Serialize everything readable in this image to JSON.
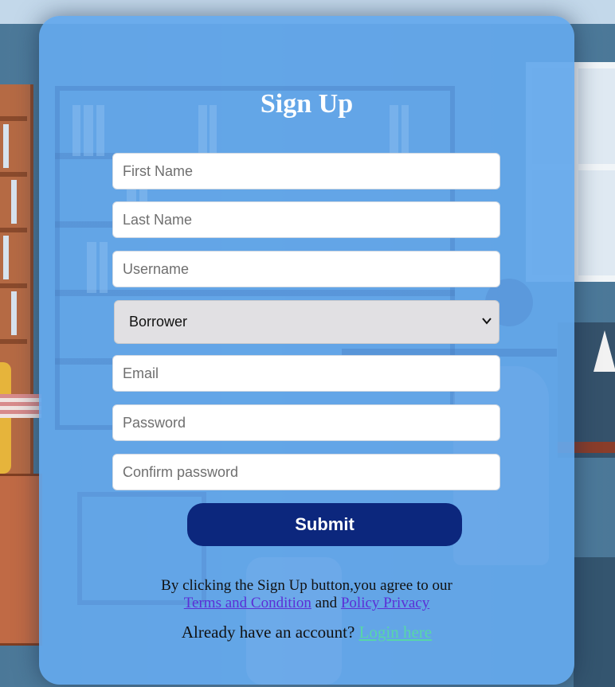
{
  "form": {
    "title": "Sign Up",
    "fields": {
      "first_name": {
        "placeholder": "First Name",
        "value": ""
      },
      "last_name": {
        "placeholder": "Last Name",
        "value": ""
      },
      "username": {
        "placeholder": "Username",
        "value": ""
      },
      "email": {
        "placeholder": "Email",
        "value": ""
      },
      "password": {
        "placeholder": "Password",
        "value": ""
      },
      "confirm_password": {
        "placeholder": "Confirm password",
        "value": ""
      }
    },
    "role_select": {
      "selected": "Borrower"
    },
    "submit_label": "Submit"
  },
  "footer": {
    "terms_prefix": "By clicking the Sign Up button,you agree to our",
    "terms_link": "Terms and Condition",
    "and_text": "and",
    "privacy_link": "Policy Privacy",
    "login_prompt": "Already have an account?",
    "login_link": "Login here"
  },
  "colors": {
    "card_bg": "#64a8ec",
    "submit_bg": "#0c277d",
    "terms_link": "#5b2fd6",
    "login_link": "#58d6a8"
  },
  "icons": {
    "select_arrow": "chevron-down-icon"
  }
}
